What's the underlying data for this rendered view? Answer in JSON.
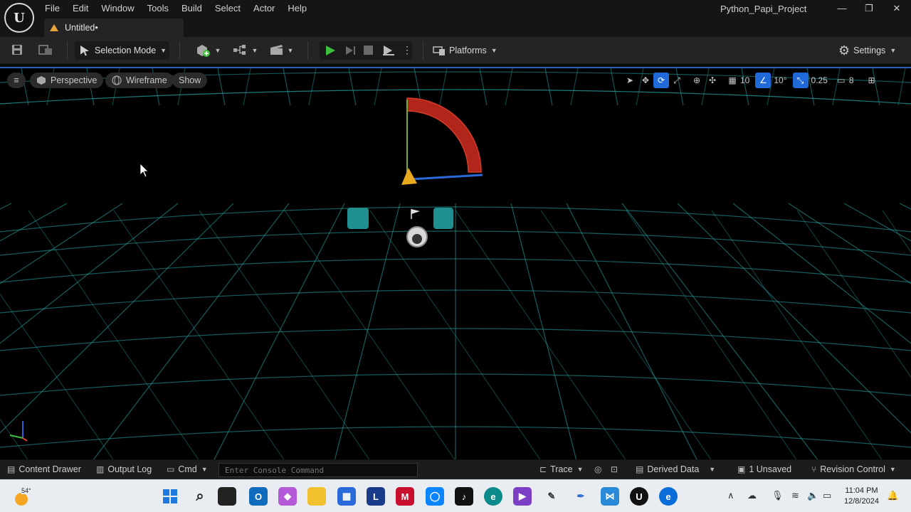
{
  "window": {
    "project_name": "Python_Papi_Project",
    "doc_tab": "Untitled•",
    "menu": [
      "File",
      "Edit",
      "Window",
      "Tools",
      "Build",
      "Select",
      "Actor",
      "Help"
    ],
    "controls": {
      "minimize": "—",
      "maximize": "❐",
      "close": "✕"
    }
  },
  "toolbar": {
    "selection_mode": "Selection Mode",
    "platforms": "Platforms",
    "settings": "Settings"
  },
  "viewport": {
    "perspective": "Perspective",
    "wireframe": "Wireframe",
    "show": "Show",
    "grid_snap": "10",
    "rotation_snap": "10°",
    "scale_snap": "0.25",
    "camera_speed": "8",
    "grid_color": "#2aa9a9"
  },
  "statusbar": {
    "content_drawer": "Content Drawer",
    "output_log": "Output Log",
    "cmd": "Cmd",
    "console_placeholder": "Enter Console Command",
    "trace": "Trace",
    "derived_data": "Derived Data",
    "unsaved": "1 Unsaved",
    "revision_control": "Revision Control"
  },
  "taskbar": {
    "temperature": "54°",
    "time": "11:04 PM",
    "date": "12/8/2024"
  }
}
